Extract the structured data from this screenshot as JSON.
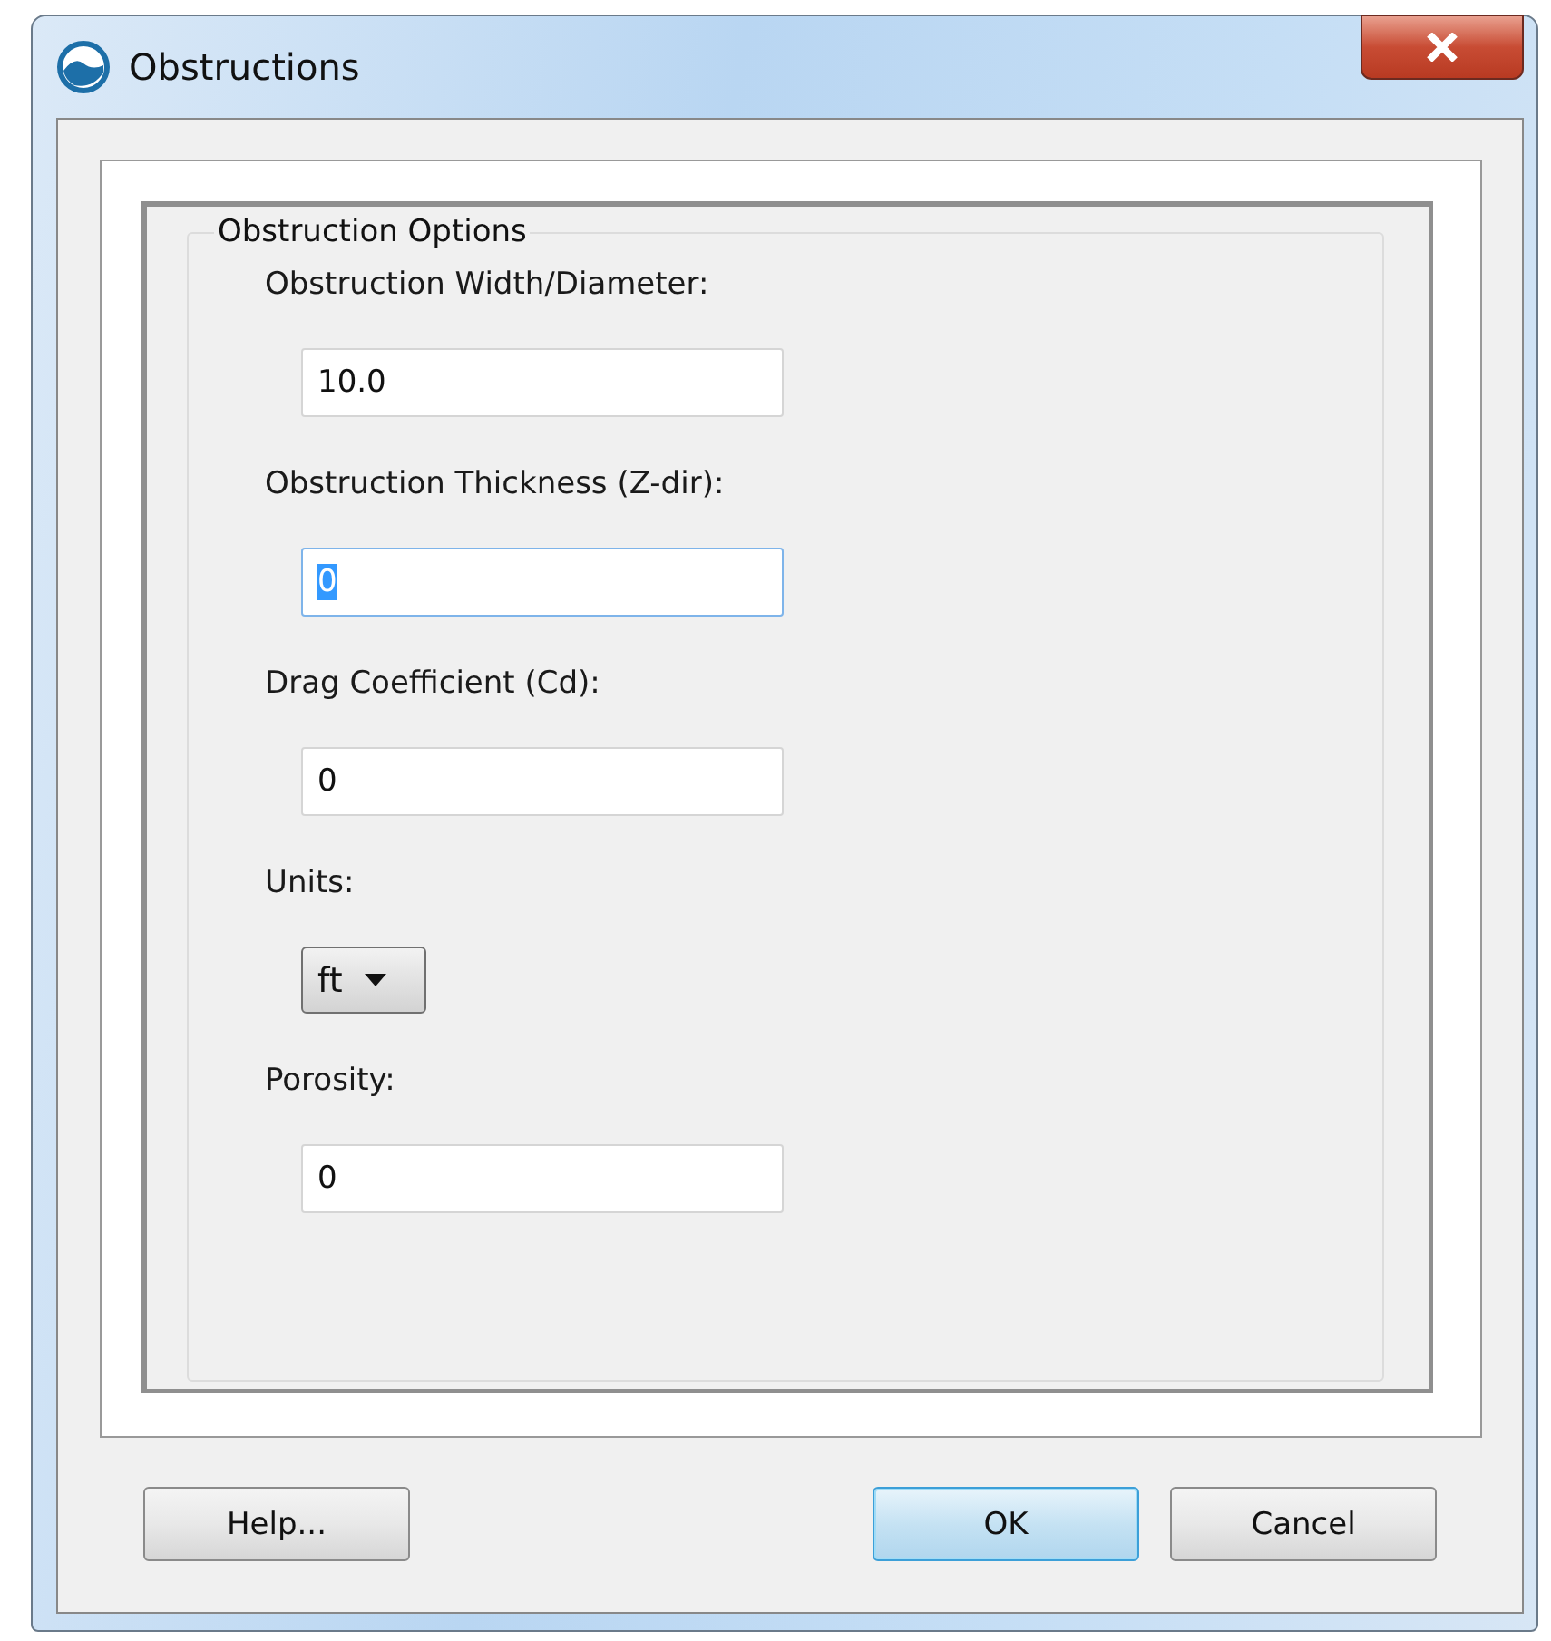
{
  "window": {
    "title": "Obstructions"
  },
  "group": {
    "title": "Obstruction Options",
    "fields": [
      {
        "kind": "text",
        "label": "Obstruction Width/Diameter:",
        "value": "10.0",
        "focused": false
      },
      {
        "kind": "text",
        "label": "Obstruction Thickness (Z-dir):",
        "value": "0",
        "focused": true
      },
      {
        "kind": "text",
        "label": "Drag Coefficient (Cd):",
        "value": "0",
        "focused": false
      },
      {
        "kind": "select",
        "label": "Units:",
        "value": "ft",
        "focused": false
      },
      {
        "kind": "text",
        "label": "Porosity:",
        "value": "0",
        "focused": false
      }
    ]
  },
  "buttons": [
    {
      "label": "Help...",
      "default": false
    },
    {
      "label": "OK",
      "default": true
    },
    {
      "label": "Cancel",
      "default": false
    }
  ]
}
